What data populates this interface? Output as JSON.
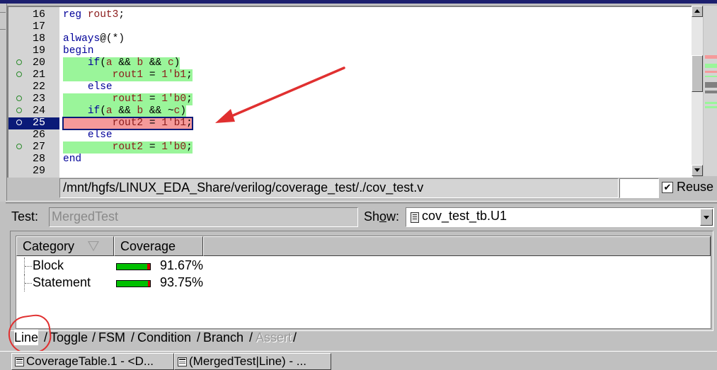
{
  "editor": {
    "lines": [
      {
        "num": "16",
        "code": "reg rout3;",
        "covered": null,
        "hl": "none"
      },
      {
        "num": "17",
        "code": "",
        "covered": null,
        "hl": "none"
      },
      {
        "num": "18",
        "code": "always@(*)",
        "covered": null,
        "hl": "none"
      },
      {
        "num": "19",
        "code": "begin",
        "covered": null,
        "hl": "none"
      },
      {
        "num": "20",
        "code": "    if(a && b && c)",
        "covered": true,
        "hl": "hit"
      },
      {
        "num": "21",
        "code": "        rout1 = 1'b1;",
        "covered": true,
        "hl": "hit"
      },
      {
        "num": "22",
        "code": "    else",
        "covered": null,
        "hl": "none"
      },
      {
        "num": "23",
        "code": "        rout1 = 1'b0;",
        "covered": true,
        "hl": "hit"
      },
      {
        "num": "24",
        "code": "    if(a && b && ~c)",
        "covered": true,
        "hl": "hit"
      },
      {
        "num": "25",
        "code": "        rout2 = 1'b1;",
        "covered": true,
        "hl": "miss"
      },
      {
        "num": "26",
        "code": "    else",
        "covered": null,
        "hl": "none"
      },
      {
        "num": "27",
        "code": "        rout2 = 1'b0;",
        "covered": true,
        "hl": "hit"
      },
      {
        "num": "28",
        "code": "end",
        "covered": null,
        "hl": "none"
      },
      {
        "num": "29",
        "code": "",
        "covered": null,
        "hl": "none"
      }
    ],
    "selected_line": "25",
    "colors": {
      "covered": "#9af59a",
      "uncovered": "#f59a9a",
      "selection": "#0a1a78"
    }
  },
  "pathbar": {
    "path": "/mnt/hgfs/LINUX_EDA_Share/verilog/coverage_test/./cov_test.v"
  },
  "reuse": {
    "label": "Reuse",
    "checked": true
  },
  "test": {
    "label": "Test:",
    "value": "MergedTest"
  },
  "show": {
    "label_pre": "Sh",
    "label_u": "o",
    "label_post": "w:",
    "value": "cov_test_tb.U1",
    "icon": "module-icon"
  },
  "table": {
    "headers": [
      "Category",
      "Coverage"
    ],
    "rows": [
      {
        "name": "Block",
        "coverage": "91.67%",
        "fraction": 0.9167
      },
      {
        "name": "Statement",
        "coverage": "93.75%",
        "fraction": 0.9375
      }
    ]
  },
  "tabs": [
    {
      "label": "Line",
      "active": true,
      "disabled": false
    },
    {
      "label": "Toggle",
      "active": false,
      "disabled": false
    },
    {
      "label": "FSM",
      "active": false,
      "disabled": false
    },
    {
      "label": "Condition",
      "active": false,
      "disabled": false
    },
    {
      "label": "Branch",
      "active": false,
      "disabled": false
    },
    {
      "label": "Assert",
      "active": false,
      "disabled": true
    }
  ],
  "taskbar": [
    {
      "label": "CoverageTable.1 - <D...",
      "icon": "table-icon"
    },
    {
      "label": "(MergedTest|Line) - ...",
      "icon": "table-icon"
    }
  ]
}
